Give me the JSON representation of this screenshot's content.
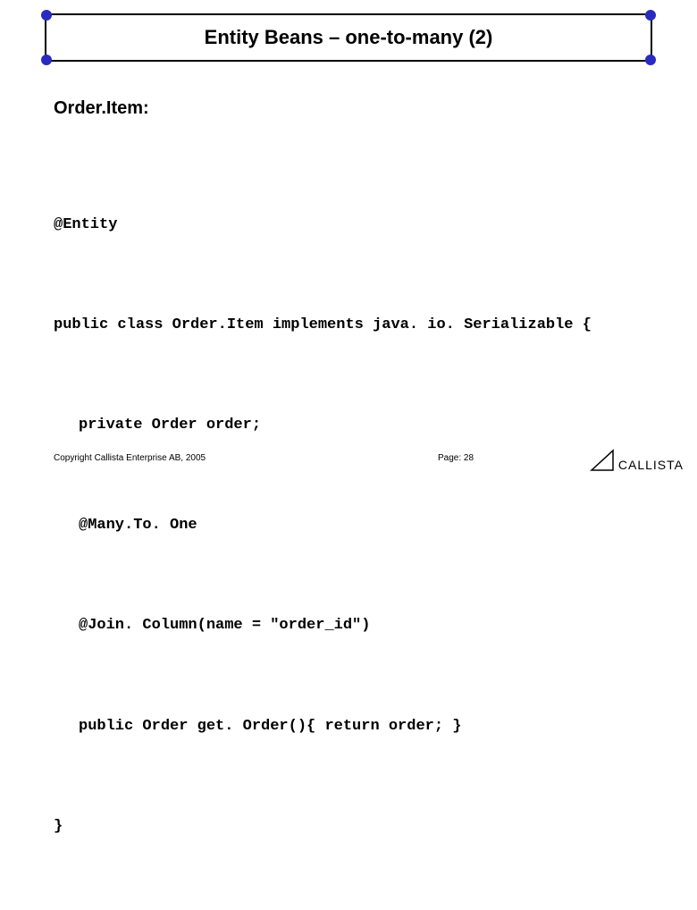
{
  "title": "Entity Beans – one-to-many (2)",
  "heading": "Order.Item:",
  "code": {
    "l1": "@Entity",
    "l2": "public class Order.Item implements java. io. Serializable {",
    "l3": "private Order order;",
    "l4": "@Many.To. One",
    "l5": "@Join. Column(name = \"order_id\")",
    "l6": "public Order get. Order(){ return order; }",
    "l7": "}"
  },
  "footer": {
    "copyright": "Copyright Callista Enterprise AB, 2005",
    "page_label": "Page: 28",
    "logo_text": "CALLISTA"
  }
}
